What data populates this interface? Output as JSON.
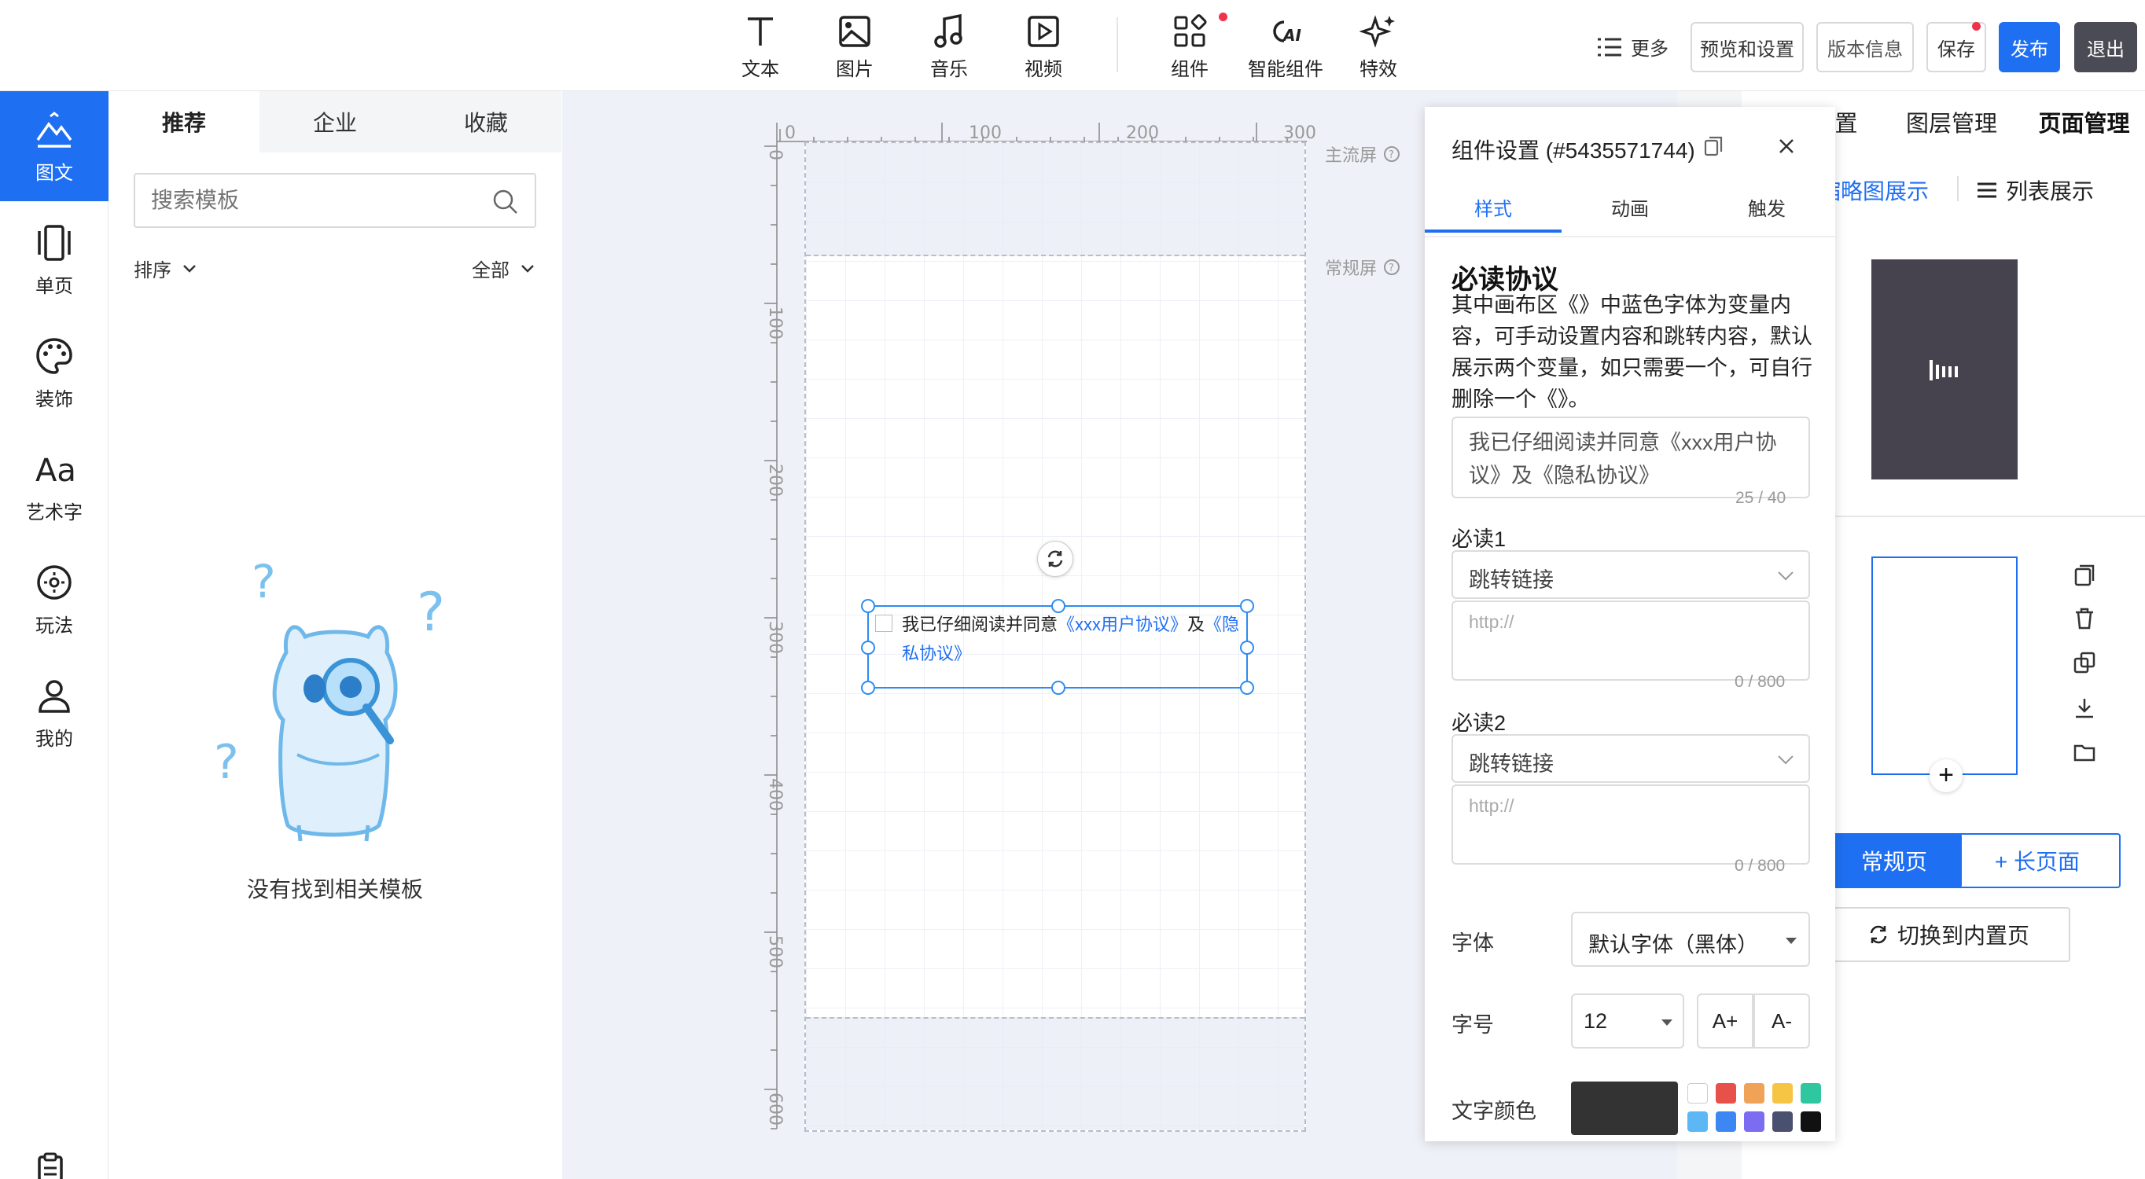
{
  "toolbar": {
    "tools": [
      {
        "label": "文本",
        "icon": "text-icon"
      },
      {
        "label": "图片",
        "icon": "image-icon"
      },
      {
        "label": "音乐",
        "icon": "music-icon"
      },
      {
        "label": "视频",
        "icon": "video-icon"
      },
      {
        "label": "组件",
        "icon": "components-icon"
      },
      {
        "label": "智能组件",
        "icon": "ai-icon"
      },
      {
        "label": "特效",
        "icon": "sparkle-icon"
      }
    ],
    "more": "更多",
    "preview": "预览和设置",
    "version": "版本信息",
    "save": "保存",
    "publish": "发布",
    "exit": "退出"
  },
  "sidebar": {
    "items": [
      {
        "label": "图文",
        "icon": "image-text-icon",
        "active": true
      },
      {
        "label": "单页",
        "icon": "single-page-icon"
      },
      {
        "label": "装饰",
        "icon": "palette-icon"
      },
      {
        "label": "艺术字",
        "icon": "art-font-icon"
      },
      {
        "label": "玩法",
        "icon": "gameplay-icon"
      },
      {
        "label": "我的",
        "icon": "user-icon"
      }
    ]
  },
  "templates": {
    "tabs": [
      "推荐",
      "企业",
      "收藏"
    ],
    "search_placeholder": "搜索模板",
    "sort": "排序",
    "filter": "全部",
    "empty": "没有找到相关模板"
  },
  "canvas": {
    "ruler_top": [
      "0",
      "100",
      "200",
      "300"
    ],
    "ruler_left": [
      "0",
      "100",
      "200",
      "300",
      "400",
      "500",
      "600"
    ],
    "main_screen": "主流屏",
    "normal_screen": "常规屏",
    "checkbox_text": "我已仔细阅读并同意",
    "link1": "《xxx用户协议》",
    "and": "及",
    "link2": "《隐私协议》"
  },
  "settings": {
    "title": "组件设置 (#5435571744)",
    "tabs": [
      "样式",
      "动画",
      "触发"
    ],
    "heading": "必读协议",
    "desc": "其中画布区《》中蓝色字体为变量内容，可手动设置内容和跳转内容，默认展示两个变量，如只需要一个，可自行删除一个《》。",
    "textarea": "我已仔细阅读并同意《xxx用户协议》及《隐私协议》",
    "count": "25 / 40",
    "read1": "必读1",
    "read2": "必读2",
    "jump": "跳转链接",
    "url_placeholder": "http://",
    "url_count": "0 / 800",
    "font_label": "字体",
    "font_value": "默认字体（黑体）",
    "size_label": "字号",
    "size_value": "12",
    "size_up": "A+",
    "size_down": "A-",
    "color_label": "文字颜色",
    "colors": [
      "#ffffff",
      "#e8504a",
      "#f0a256",
      "#f6c543",
      "#2ec7a0",
      "#5bb8f5",
      "#3d87f2",
      "#7b6cf2",
      "#4a5170",
      "#111111"
    ],
    "current_color": "#333333"
  },
  "right": {
    "tabs": [
      "置",
      "图层管理",
      "页面管理"
    ],
    "view_thumb": "缩略图展示",
    "view_list": "列表展示",
    "normal_page": "常规页",
    "long_page": "+ 长页面",
    "switch": "切换到内置页"
  }
}
